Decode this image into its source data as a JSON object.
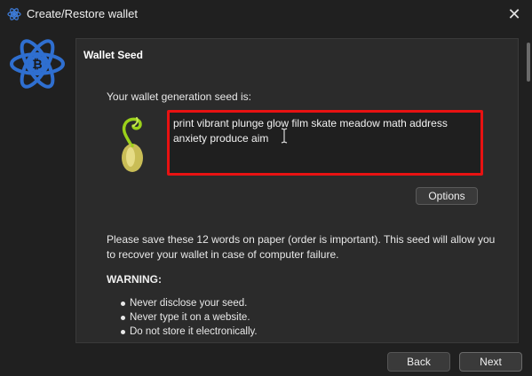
{
  "window": {
    "title": "Create/Restore wallet",
    "close_symbol": "✕",
    "accent_color": "#3d7bd8"
  },
  "page": {
    "section_title": "Wallet Seed",
    "seed_label": "Your wallet generation seed is:",
    "seed_words": "print vibrant plunge glow film skate meadow math address anxiety produce aim",
    "highlight_color": "#e81212",
    "options_label": "Options",
    "info_text": "Please save these 12 words on paper (order is important). This seed will allow you to recover your wallet in case of computer failure.",
    "warning_title": "WARNING:",
    "warnings": [
      "Never disclose your seed.",
      "Never type it on a website.",
      "Do not store it electronically."
    ]
  },
  "footer": {
    "back_label": "Back",
    "next_label": "Next"
  },
  "icons": {
    "app_icon": "electrum-logo-icon",
    "sprout_icon": "seed-sprout-icon",
    "cursor_icon": "text-cursor-icon"
  }
}
